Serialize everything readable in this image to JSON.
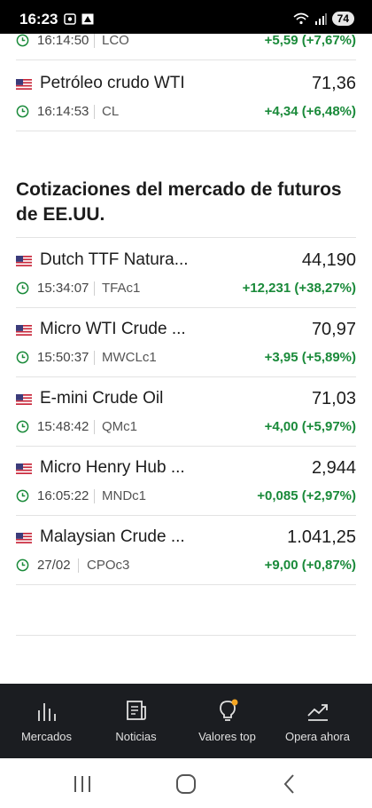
{
  "status": {
    "time": "16:23",
    "battery": "74"
  },
  "quotes_top": [
    {
      "name": "",
      "price": "",
      "time": "16:14:50",
      "symbol": "LCO",
      "change": "+5,59  (+7,67%)"
    },
    {
      "name": "Petróleo crudo WTI",
      "price": "71,36",
      "time": "16:14:53",
      "symbol": "CL",
      "change": "+4,34  (+6,48%)"
    }
  ],
  "section": {
    "title": "Cotizaciones del mercado de futuros de EE.UU."
  },
  "quotes_futures": [
    {
      "name": "Dutch TTF Natura...",
      "price": "44,190",
      "time": "15:34:07",
      "symbol": "TFAc1",
      "change": "+12,231  (+38,27%)"
    },
    {
      "name": "Micro WTI Crude ...",
      "price": "70,97",
      "time": "15:50:37",
      "symbol": "MWCLc1",
      "change": "+3,95  (+5,89%)"
    },
    {
      "name": "E-mini Crude Oil",
      "price": "71,03",
      "time": "15:48:42",
      "symbol": "QMc1",
      "change": "+4,00  (+5,97%)"
    },
    {
      "name": "Micro Henry Hub ...",
      "price": "2,944",
      "time": "16:05:22",
      "symbol": "MNDc1",
      "change": "+0,085  (+2,97%)"
    },
    {
      "name": "Malaysian Crude ...",
      "price": "1.041,25",
      "time": "27/02",
      "symbol": "CPOc3",
      "change": "+9,00  (+0,87%)"
    }
  ],
  "nav": {
    "markets": "Mercados",
    "news": "Noticias",
    "top": "Valores top",
    "trade": "Opera ahora"
  },
  "colors": {
    "positive": "#1a8a3a",
    "nav_bg": "#1b1d21",
    "notification_dot": "#f5a623"
  }
}
